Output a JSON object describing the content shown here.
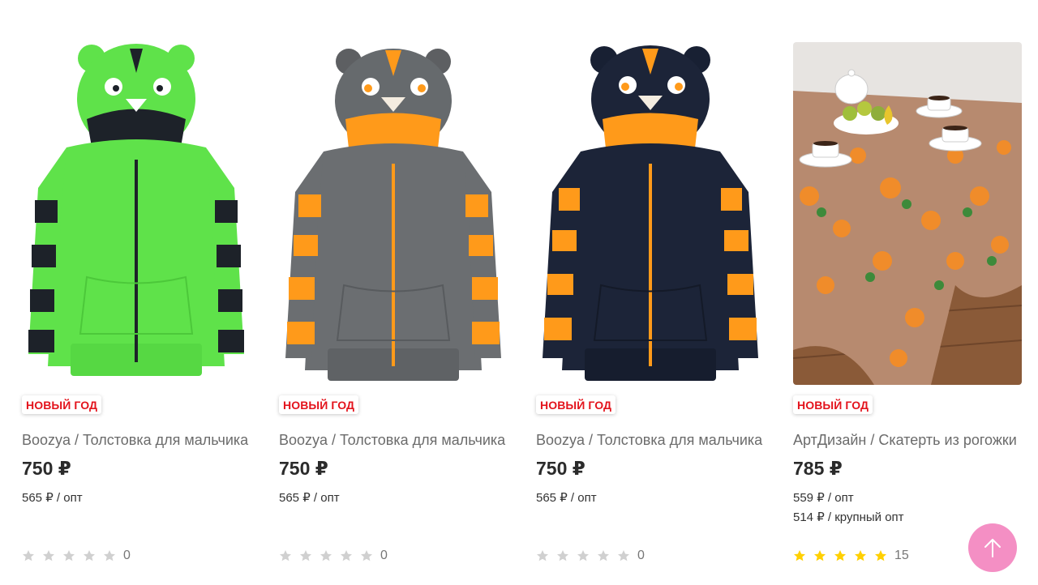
{
  "products": [
    {
      "badge": "НОВЫЙ ГОД",
      "title": "Boozya / Толстовка для мальчика",
      "price": "750 ₽",
      "opt_prices": [
        "565 ₽ / опт"
      ],
      "rating_filled": 0,
      "rating_count": "0",
      "image_icon": "green-tiger-hoodie-image"
    },
    {
      "badge": "НОВЫЙ ГОД",
      "title": "Boozya / Толстовка для мальчика",
      "price": "750 ₽",
      "opt_prices": [
        "565 ₽ / опт"
      ],
      "rating_filled": 0,
      "rating_count": "0",
      "image_icon": "gray-tiger-hoodie-image"
    },
    {
      "badge": "НОВЫЙ ГОД",
      "title": "Boozya / Толстовка для мальчика",
      "price": "750 ₽",
      "opt_prices": [
        "565 ₽ / опт"
      ],
      "rating_filled": 0,
      "rating_count": "0",
      "image_icon": "navy-tiger-hoodie-image"
    },
    {
      "badge": "НОВЫЙ ГОД",
      "title": "АртДизайн / Скатерть из рогожки",
      "price": "785 ₽",
      "opt_prices": [
        "559 ₽ / опт",
        "514 ₽ / крупный опт"
      ],
      "rating_filled": 5,
      "rating_count": "15",
      "image_icon": "tablecloth-image"
    }
  ],
  "colors": {
    "badge_text": "#e3131c",
    "star_filled": "#ffd000",
    "star_empty": "#d0d0d0",
    "scroll_button": "#f48fc4"
  },
  "scroll_top_icon": "arrow-up-icon"
}
